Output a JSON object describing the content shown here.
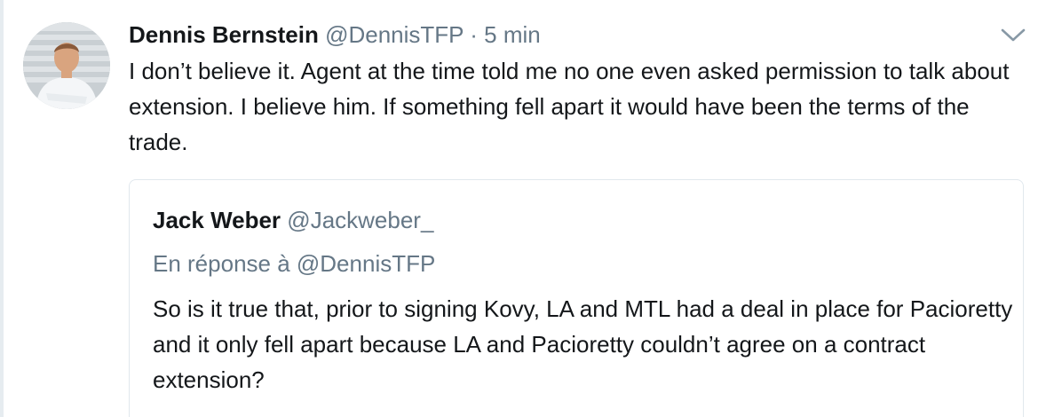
{
  "tweet": {
    "author_name": "Dennis Bernstein",
    "author_handle": "@DennisTFP",
    "separator": "·",
    "timestamp": "5 min",
    "text": "I don’t believe it. Agent at the time told me no one even asked permission to talk about extension. I believe him. If something fell apart it would have been the terms of the trade."
  },
  "quoted_tweet": {
    "author_name": "Jack Weber",
    "author_handle": "@Jackweber_",
    "reply_context": "En réponse à @DennisTFP",
    "text": "So is it true that, prior to signing Kovy, LA and MTL had a deal in place for Pacioretty and it only fell apart because LA and Pacioretty couldn’t agree on a contract extension?"
  },
  "icons": {
    "menu": "chevron-down-icon",
    "avatar": "profile-photo"
  },
  "colors": {
    "primary_text": "#14171a",
    "secondary_text": "#657786",
    "border": "#e1e8ed"
  }
}
